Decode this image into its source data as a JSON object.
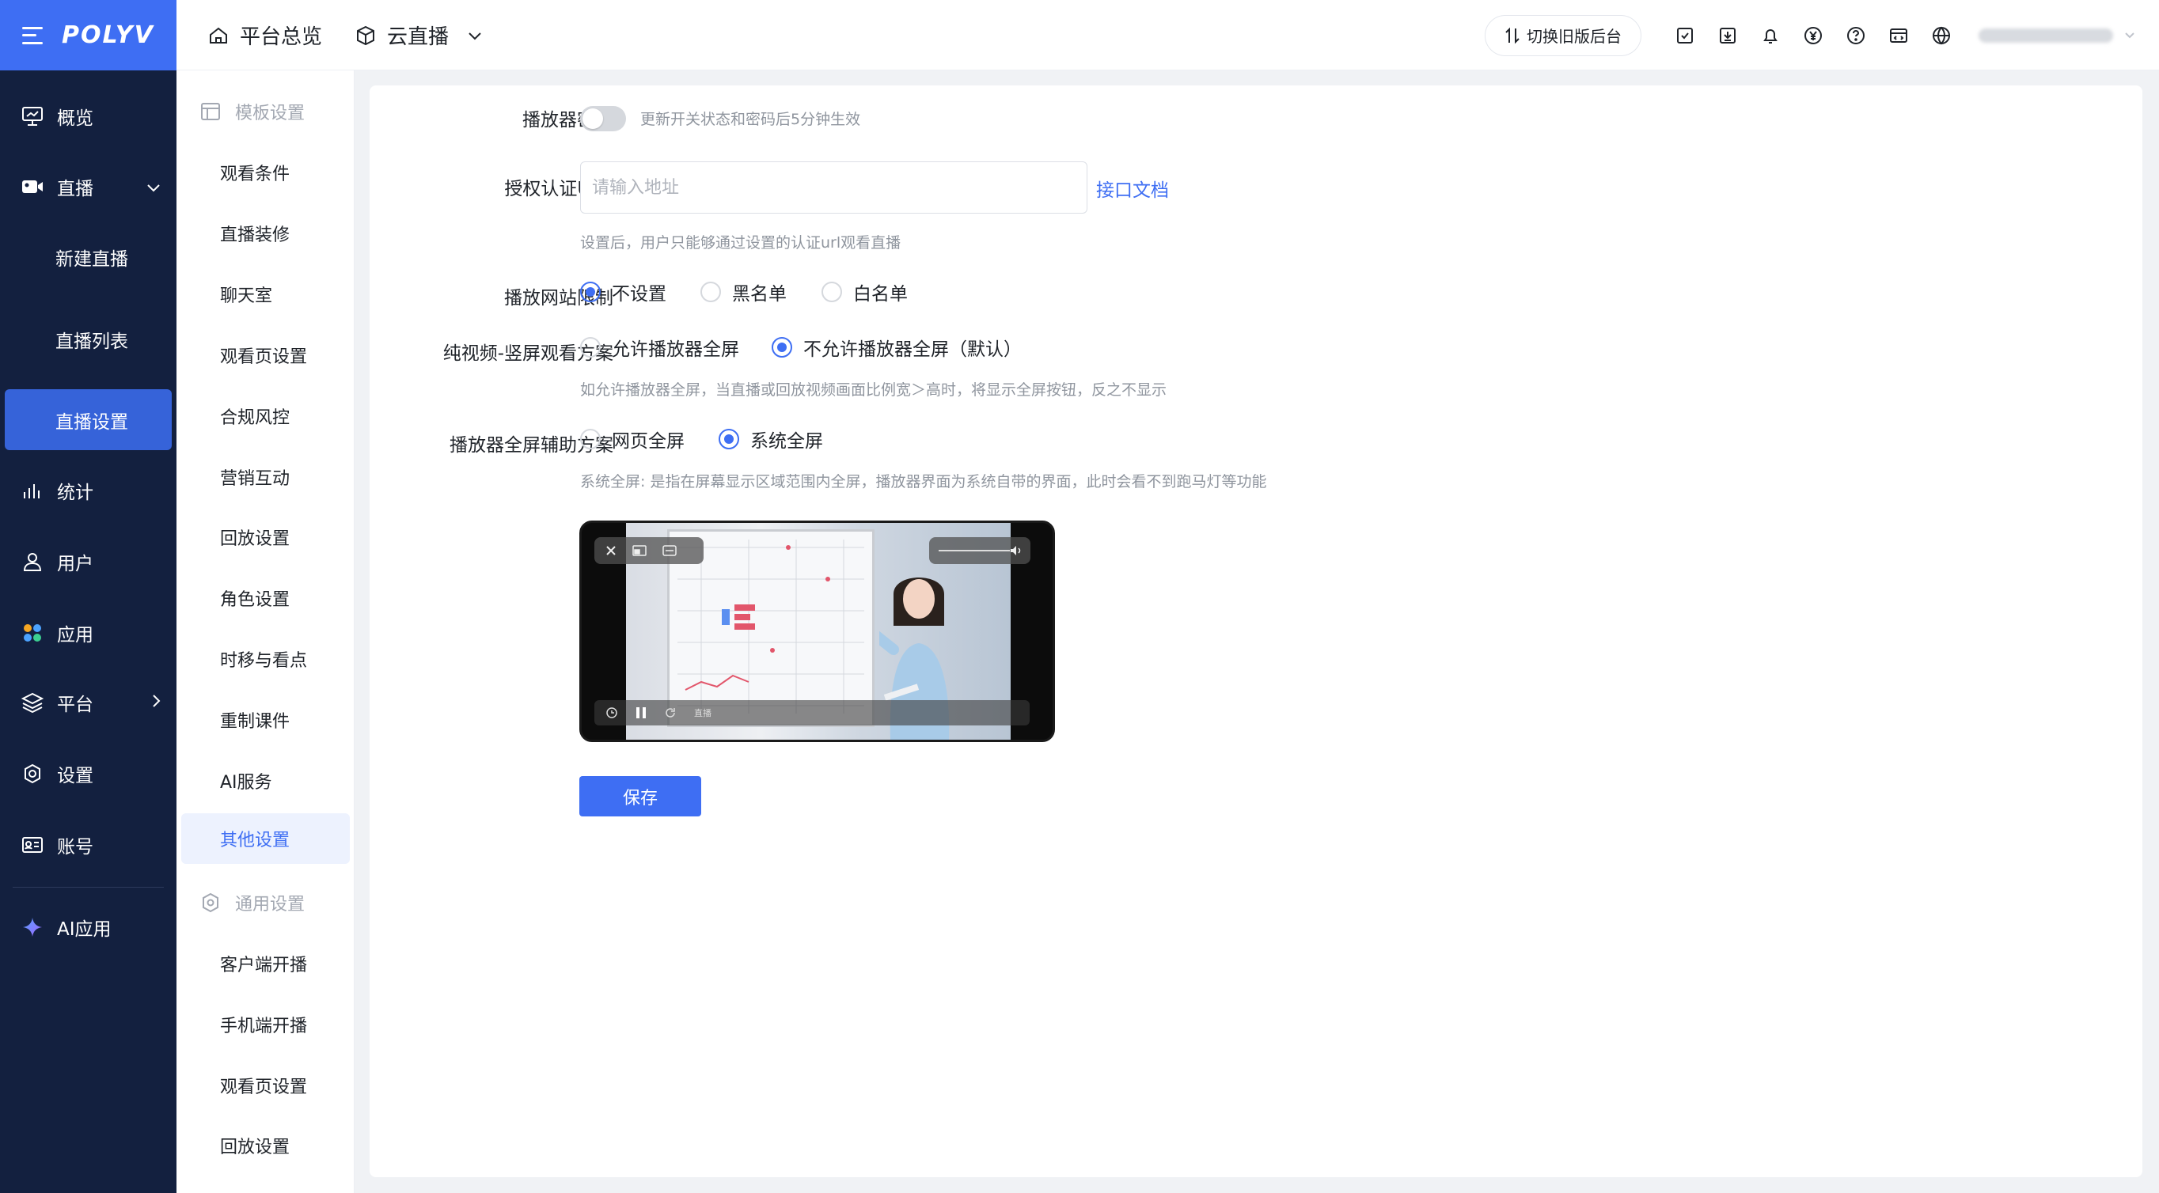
{
  "brand": {
    "name": "POLYV",
    "color": "#3e6ef3"
  },
  "nav": {
    "items": [
      {
        "label": "概览",
        "icon": "monitor-icon"
      },
      {
        "label": "直播",
        "icon": "video-camera-icon"
      },
      {
        "label": "新建直播"
      },
      {
        "label": "直播列表"
      },
      {
        "label": "直播设置"
      },
      {
        "label": "统计",
        "icon": "bar-chart-icon"
      },
      {
        "label": "用户",
        "icon": "user-icon"
      },
      {
        "label": "应用",
        "icon": "apps-icon"
      },
      {
        "label": "平台",
        "icon": "layers-icon"
      },
      {
        "label": "设置",
        "icon": "gear-icon"
      },
      {
        "label": "账号",
        "icon": "id-card-icon"
      },
      {
        "label": "AI应用",
        "icon": "sparkle-icon"
      }
    ]
  },
  "topbar": {
    "home": "平台总览",
    "product": "云直播",
    "switch_old": "切换旧版后台",
    "icons": [
      "checklist-icon",
      "download-icon",
      "bell-icon",
      "yen-icon",
      "help-icon",
      "code-window-icon",
      "globe-icon"
    ]
  },
  "submenu": {
    "group1": "模板设置",
    "group1_items": [
      "观看条件",
      "直播装修",
      "聊天室",
      "观看页设置",
      "合规风控",
      "营销互动",
      "回放设置",
      "角色设置",
      "时移与看点",
      "重制课件",
      "AI服务",
      "其他设置"
    ],
    "group2": "通用设置",
    "group2_items": [
      "客户端开播",
      "手机端开播",
      "观看页设置",
      "回放设置"
    ]
  },
  "form": {
    "player_password": {
      "label": "播放器密码",
      "hint": "更新开关状态和密码后5分钟生效",
      "enabled": false
    },
    "auth_url": {
      "label": "授权认证URL",
      "placeholder": "请输入地址",
      "value": "",
      "link": "接口文档",
      "hint": "设置后，用户只能够通过设置的认证url观看直播"
    },
    "site_limit": {
      "label": "播放网站限制",
      "options": [
        "不设置",
        "黑名单",
        "白名单"
      ],
      "selected": "不设置"
    },
    "vertical_scheme": {
      "label": "纯视频-竖屏观看方案",
      "options": [
        "允许播放器全屏",
        "不允许播放器全屏（默认）"
      ],
      "selected": "不允许播放器全屏（默认）",
      "hint": "如允许播放器全屏，当直播或回放视频画面比例宽＞高时，将显示全屏按钮，反之不显示"
    },
    "fullscreen_scheme": {
      "label": "播放器全屏辅助方案",
      "options": [
        "网页全屏",
        "系统全屏"
      ],
      "selected": "系统全屏",
      "hint": "系统全屏: 是指在屏幕显示区域范围内全屏，播放器界面为系统自带的界面，此时会看不到跑马灯等功能"
    },
    "preview_live_tag": "直播",
    "save": "保存"
  }
}
